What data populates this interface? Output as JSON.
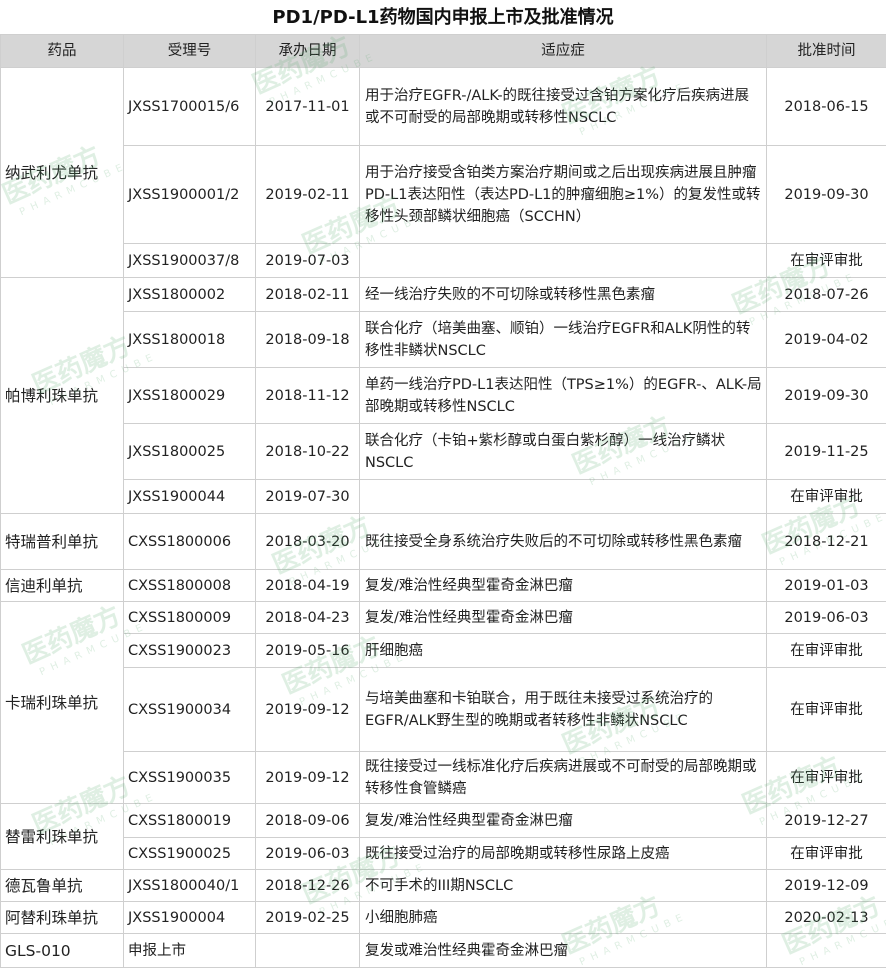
{
  "title": "PD1/PD-L1药物国内申报上市及批准情况",
  "headers": [
    "药品",
    "受理号",
    "承办日期",
    "适应症",
    "批准时间"
  ],
  "watermark": {
    "main": "医药魔方",
    "sub": "PHARMCUBE"
  },
  "groups": [
    {
      "drug": "纳武利尤单抗",
      "rows": [
        {
          "acc": "JXSS1700015/6",
          "date": "2017-11-01",
          "ind": "用于治疗EGFR-/ALK-的既往接受过含铂方案化疗后疾病进展或不可耐受的局部晚期或转移性NSCLC",
          "appr": "2018-06-15"
        },
        {
          "acc": "JXSS1900001/2",
          "date": "2019-02-11",
          "ind": "用于治疗接受含铂类方案治疗期间或之后出现疾病进展且肿瘤PD-L1表达阳性（表达PD-L1的肿瘤细胞≥1%）的复发性或转移性头颈部鳞状细胞癌（SCCHN）",
          "appr": "2019-09-30"
        },
        {
          "acc": "JXSS1900037/8",
          "date": "2019-07-03",
          "ind": "",
          "appr": "在审评审批"
        }
      ]
    },
    {
      "drug": "帕博利珠单抗",
      "rows": [
        {
          "acc": "JXSS1800002",
          "date": "2018-02-11",
          "ind": "经一线治疗失败的不可切除或转移性黑色素瘤",
          "appr": "2018-07-26"
        },
        {
          "acc": "JXSS1800018",
          "date": "2018-09-18",
          "ind": "联合化疗（培美曲塞、顺铂）一线治疗EGFR和ALK阴性的转移性非鳞状NSCLC",
          "appr": "2019-04-02"
        },
        {
          "acc": "JXSS1800029",
          "date": "2018-11-12",
          "ind": "单药一线治疗PD-L1表达阳性（TPS≥1%）的EGFR-、ALK-局部晚期或转移性NSCLC",
          "appr": "2019-09-30"
        },
        {
          "acc": "JXSS1800025",
          "date": "2018-10-22",
          "ind": "联合化疗（卡铂+紫杉醇或白蛋白紫杉醇）一线治疗鳞状NSCLC",
          "appr": "2019-11-25"
        },
        {
          "acc": "JXSS1900044",
          "date": "2019-07-30",
          "ind": "",
          "appr": "在审评审批"
        }
      ]
    },
    {
      "drug": "特瑞普利单抗",
      "rows": [
        {
          "acc": "CXSS1800006",
          "date": "2018-03-20",
          "ind": "既往接受全身系统治疗失败后的不可切除或转移性黑色素瘤",
          "appr": "2018-12-21"
        }
      ]
    },
    {
      "drug": "信迪利单抗",
      "rows": [
        {
          "acc": "CXSS1800008",
          "date": "2018-04-19",
          "ind": "复发/难治性经典型霍奇金淋巴瘤",
          "appr": "2019-01-03"
        }
      ]
    },
    {
      "drug": "卡瑞利珠单抗",
      "rows": [
        {
          "acc": "CXSS1800009",
          "date": "2018-04-23",
          "ind": "复发/难治性经典型霍奇金淋巴瘤",
          "appr": "2019-06-03"
        },
        {
          "acc": "CXSS1900023",
          "date": "2019-05-16",
          "ind": "肝细胞癌",
          "appr": "在审评审批"
        },
        {
          "acc": "CXSS1900034",
          "date": "2019-09-12",
          "ind": "与培美曲塞和卡铂联合，用于既往未接受过系统治疗的EGFR/ALK野生型的晚期或者转移性非鳞状NSCLC",
          "appr": "在审评审批",
          "justify": true
        },
        {
          "acc": "CXSS1900035",
          "date": "2019-09-12",
          "ind": "既往接受过一线标准化疗后疾病进展或不可耐受的局部晚期或转移性食管鳞癌",
          "appr": "在审评审批"
        }
      ]
    },
    {
      "drug": "替雷利珠单抗",
      "rows": [
        {
          "acc": "CXSS1800019",
          "date": "2018-09-06",
          "ind": "复发/难治性经典型霍奇金淋巴瘤",
          "appr": "2019-12-27"
        },
        {
          "acc": "CXSS1900025",
          "date": "2019-06-03",
          "ind": "既往接受过治疗的局部晚期或转移性尿路上皮癌",
          "appr": "在审评审批"
        }
      ]
    },
    {
      "drug": "德瓦鲁单抗",
      "rows": [
        {
          "acc": "JXSS1800040/1",
          "date": "2018-12-26",
          "ind": "不可手术的III期NSCLC",
          "appr": "2019-12-09"
        }
      ]
    },
    {
      "drug": "阿替利珠单抗",
      "rows": [
        {
          "acc": "JXSS1900004",
          "date": "2019-02-25",
          "ind": "小细胞肺癌",
          "appr": "2020-02-13"
        }
      ]
    },
    {
      "drug": "GLS-010",
      "rows": [
        {
          "acc": "申报上市",
          "date": "",
          "ind": "复发或难治性经典霍奇金淋巴瘤",
          "appr": ""
        }
      ]
    }
  ]
}
